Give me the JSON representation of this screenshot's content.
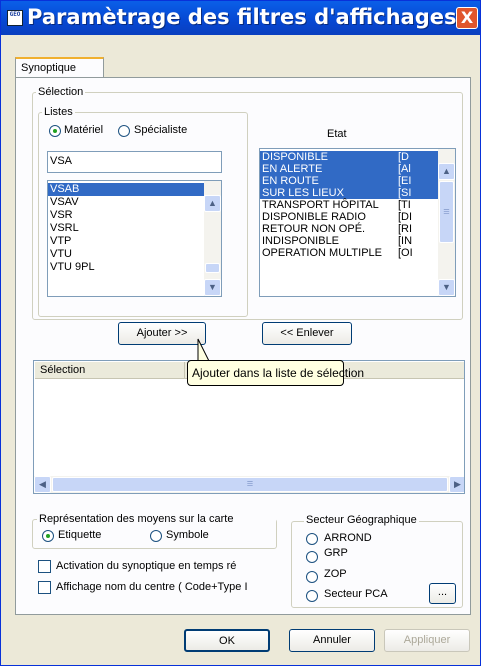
{
  "window": {
    "title": "Paramètrage des filtres d'affichages",
    "close_glyph": "X",
    "icon_text": "GEO"
  },
  "tabs": [
    {
      "label": "Synoptique"
    }
  ],
  "selection_group": {
    "label": "Sélection"
  },
  "listes_group": {
    "label": "Listes",
    "radio_materiel": "Matériel",
    "radio_specialiste": "Spécialiste",
    "materiel_checked": true
  },
  "etat": {
    "header": "Etat",
    "items": [
      {
        "name": "DISPONIBLE",
        "code": "[D",
        "selected": true
      },
      {
        "name": "EN ALERTE",
        "code": "[Al",
        "selected": true
      },
      {
        "name": "EN ROUTE",
        "code": "[EI",
        "selected": true
      },
      {
        "name": "SUR LES LIEUX",
        "code": "[SI",
        "selected": true
      },
      {
        "name": "TRANSPORT HÔPITAL",
        "code": "[TI",
        "selected": false
      },
      {
        "name": "DISPONIBLE RADIO",
        "code": "[DI",
        "selected": false
      },
      {
        "name": "RETOUR NON OPÉ.",
        "code": "[RI",
        "selected": false
      },
      {
        "name": "INDISPONIBLE",
        "code": "[IN",
        "selected": false
      },
      {
        "name": "OPERATION MULTIPLE",
        "code": "[OI",
        "selected": false
      }
    ]
  },
  "filter_input": {
    "value": "VSA"
  },
  "materiel_list": {
    "items": [
      {
        "label": "VSAB",
        "selected": true
      },
      {
        "label": "VSAV",
        "selected": false
      },
      {
        "label": "VSR",
        "selected": false
      },
      {
        "label": "VSRL",
        "selected": false
      },
      {
        "label": "VTP",
        "selected": false
      },
      {
        "label": "VTU",
        "selected": false
      },
      {
        "label": "VTU 9PL",
        "selected": false
      }
    ]
  },
  "buttons": {
    "ajouter": "Ajouter >>",
    "enlever": "<< Enlever",
    "ok": "OK",
    "annuler": "Annuler",
    "appliquer": "Appliquer",
    "browse": "..."
  },
  "tooltip": {
    "text": "Ajouter dans la liste de sélection"
  },
  "selection_list": {
    "header": "Sélection",
    "items": []
  },
  "representation": {
    "label": "Représentation des moyens sur la carte",
    "etiquette": "Etiquette",
    "symbole": "Symbole",
    "etiquette_checked": true
  },
  "checkboxes": {
    "activation": "Activation du synoptique en temps ré",
    "affichage": "Affichage nom du centre ( Code+Type I",
    "activation_checked": false,
    "affichage_checked": false
  },
  "secteur": {
    "label": "Secteur Géographique",
    "options": [
      "ARROND",
      "GRP",
      "ZOP",
      "Secteur PCAM"
    ]
  },
  "scroll_glyphs": {
    "up": "▲",
    "down": "▼",
    "left": "◀",
    "right": "▶",
    "grip": "≡"
  },
  "colors": {
    "title_bar": "#0647d2",
    "selection": "#316ac5",
    "tooltip_bg": "#ffffe1",
    "close": "#e0562d"
  }
}
